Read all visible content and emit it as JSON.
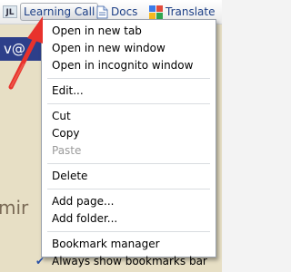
{
  "bookmarks_bar": {
    "items": [
      {
        "label": "Learning Call",
        "icon": "jl-icon",
        "icon_text": "JL"
      },
      {
        "label": "Docs",
        "icon": "docs-icon"
      },
      {
        "label": "Translate",
        "icon": "google-translate-icon"
      }
    ]
  },
  "page_background": {
    "strip_text": "v@",
    "large_text": "mir"
  },
  "context_menu": {
    "group1": [
      "Open in new tab",
      "Open in new window",
      "Open in incognito window"
    ],
    "group2": [
      "Edit..."
    ],
    "group3": [
      {
        "label": "Cut",
        "enabled": true
      },
      {
        "label": "Copy",
        "enabled": true
      },
      {
        "label": "Paste",
        "enabled": false
      }
    ],
    "group4": [
      "Delete"
    ],
    "group5": [
      "Add page...",
      "Add folder..."
    ],
    "group6": [
      {
        "label": "Bookmark manager",
        "checked": false
      },
      {
        "label": "Always show bookmarks bar",
        "checked": true
      }
    ]
  },
  "colors": {
    "annotation_arrow": "#e8322c",
    "checkmark": "#2950a5",
    "link_text": "#1c3f86"
  }
}
